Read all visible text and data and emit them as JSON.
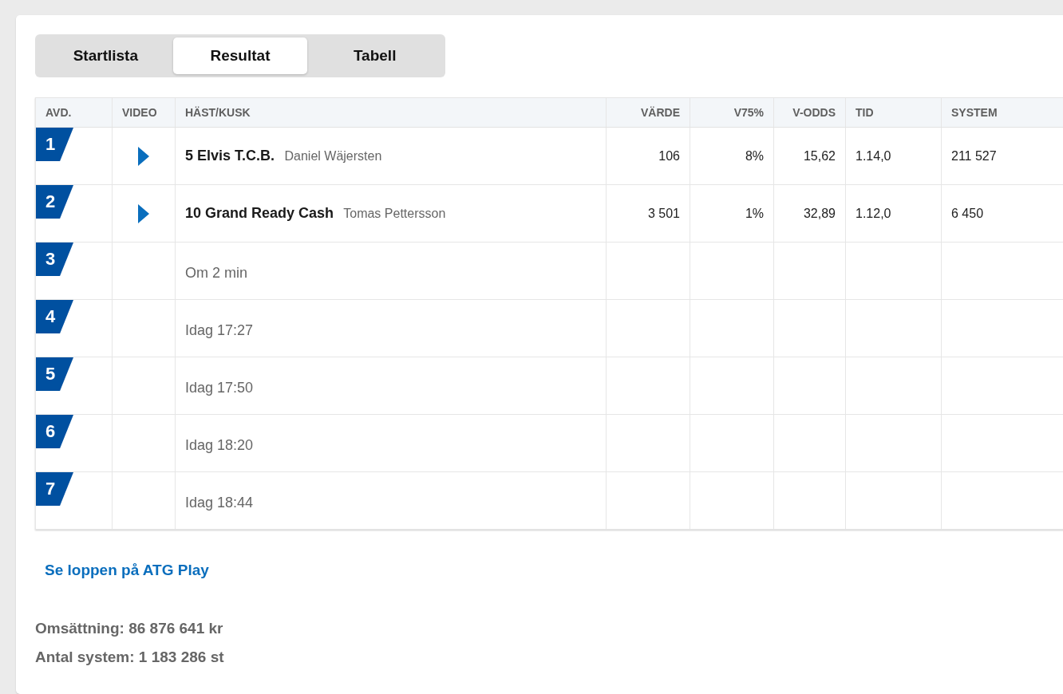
{
  "tabs": [
    {
      "label": "Startlista",
      "selected": false
    },
    {
      "label": "Resultat",
      "selected": true
    },
    {
      "label": "Tabell",
      "selected": false
    }
  ],
  "table": {
    "columns": [
      "AVD.",
      "VIDEO",
      "HÄST/KUSK",
      "VÄRDE",
      "V75%",
      "V-ODDS",
      "TID",
      "SYSTEM"
    ],
    "rows": [
      {
        "kind": "result",
        "leg": "1",
        "horse": "5 Elvis T.C.B.",
        "driver": "Daniel Wäjersten",
        "cells": [
          "106",
          "8%",
          "15,62",
          "1.14,0",
          "211 527"
        ]
      },
      {
        "kind": "result",
        "leg": "2",
        "horse": "10 Grand Ready Cash",
        "driver": "Tomas Pettersson",
        "cells": [
          "3 501",
          "1%",
          "32,89",
          "1.12,0",
          "6 450"
        ]
      },
      {
        "kind": "upcoming",
        "leg": "3",
        "start": "Om 2 min"
      },
      {
        "kind": "upcoming",
        "leg": "4",
        "start": "Idag 17:27"
      },
      {
        "kind": "upcoming",
        "leg": "5",
        "start": "Idag 17:50"
      },
      {
        "kind": "upcoming",
        "leg": "6",
        "start": "Idag 18:20"
      },
      {
        "kind": "upcoming",
        "leg": "7",
        "start": "Idag 18:44"
      }
    ]
  },
  "link": "Se loppen på ATG Play",
  "summary": [
    "Omsättning: 86 876 641 kr",
    "Antal system: 1 183 286 st"
  ]
}
